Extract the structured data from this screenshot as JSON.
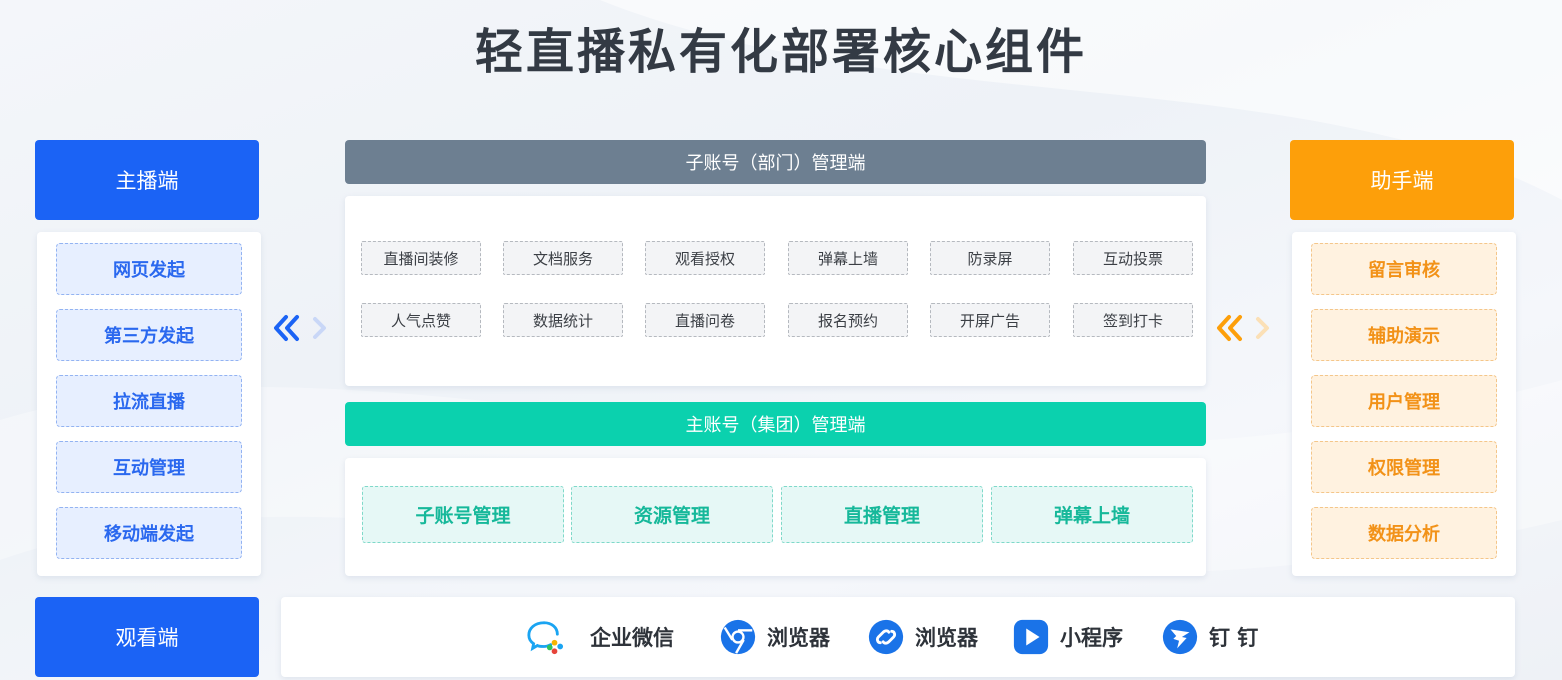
{
  "title": "轻直播私有化部署核心组件",
  "anchor": {
    "header": "主播端",
    "items": [
      "网页发起",
      "第三方发起",
      "拉流直播",
      "互动管理",
      "移动端发起"
    ]
  },
  "assistant": {
    "header": "助手端",
    "items": [
      "留言审核",
      "辅助演示",
      "用户管理",
      "权限管理",
      "数据分析"
    ]
  },
  "sub_account": {
    "header": "子账号（部门）管理端",
    "row1": [
      "直播间装修",
      "文档服务",
      "观看授权",
      "弹幕上墙",
      "防录屏",
      "互动投票"
    ],
    "row2": [
      "人气点赞",
      "数据统计",
      "直播问卷",
      "报名预约",
      "开屏广告",
      "签到打卡"
    ]
  },
  "main_account": {
    "header": "主账号（集团）管理端",
    "items": [
      "子账号管理",
      "资源管理",
      "直播管理",
      "弹幕上墙"
    ]
  },
  "viewer": {
    "header": "观看端",
    "clients": [
      {
        "label": "企业微信",
        "icon": "wecom-icon"
      },
      {
        "label": "浏览器",
        "icon": "chrome-browser-icon"
      },
      {
        "label": "浏览器",
        "icon": "link-browser-icon"
      },
      {
        "label": "小程序",
        "icon": "miniprogram-icon"
      },
      {
        "label": "钉 钉",
        "icon": "dingtalk-icon"
      }
    ]
  },
  "colors": {
    "blue": "#1b63f5",
    "orange": "#fd9f0a",
    "grey_bar": "#6d7f91",
    "teal_bar": "#0bd1ae"
  }
}
